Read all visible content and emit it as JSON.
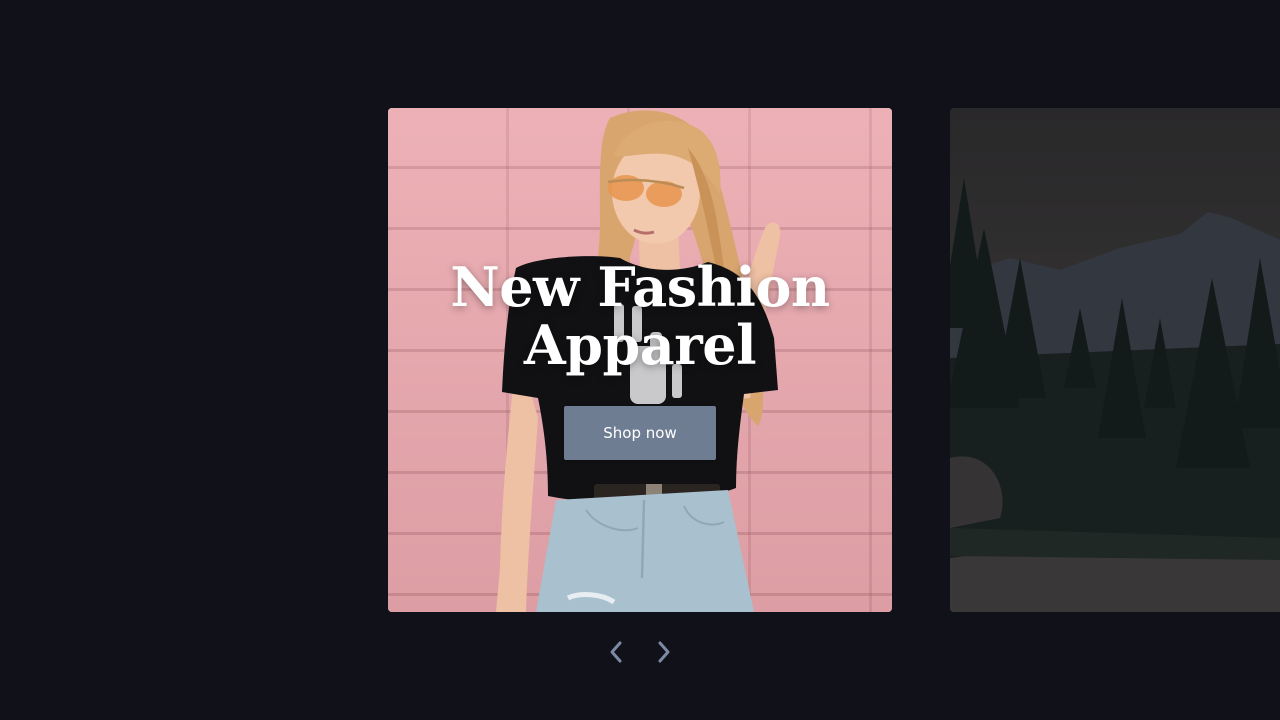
{
  "carousel": {
    "active_slide": {
      "title": "New Fashion Apparel",
      "button_label": "Shop now",
      "image": "woman-in-sunglasses-against-pink-brick-wall"
    },
    "next_slide": {
      "image": "mountain-forest-landscape-at-dusk"
    },
    "controls": {
      "prev_icon": "chevron-left-icon",
      "next_icon": "chevron-right-icon"
    }
  },
  "colors": {
    "background": "#11111a",
    "button": "#6f7d93",
    "arrow": "#7d8aa3",
    "title": "#ffffff"
  }
}
